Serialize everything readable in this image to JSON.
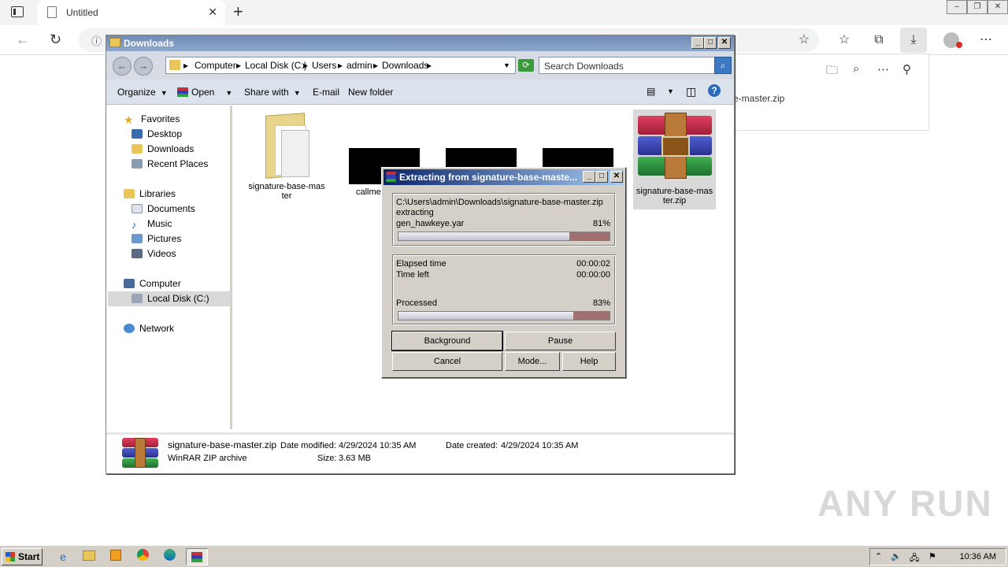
{
  "browser": {
    "tab_title": "Untitled",
    "download_item": "e-master.zip"
  },
  "explorer": {
    "title": "Downloads",
    "breadcrumbs": [
      "Computer",
      "Local Disk (C:)",
      "Users",
      "admin",
      "Downloads"
    ],
    "search_placeholder": "Search Downloads",
    "commands": {
      "organize": "Organize",
      "open": "Open",
      "share_with": "Share with",
      "email": "E-mail",
      "new_folder": "New folder"
    },
    "nav": {
      "favorites": "Favorites",
      "desktop": "Desktop",
      "downloads": "Downloads",
      "recent_places": "Recent Places",
      "libraries": "Libraries",
      "documents": "Documents",
      "music": "Music",
      "pictures": "Pictures",
      "videos": "Videos",
      "computer": "Computer",
      "local_disk": "Local Disk (C:)",
      "network": "Network"
    },
    "files": {
      "folder_name_1": "signature-base-mas",
      "folder_name_2": "ter",
      "call_name": "callmet",
      "zip_name_1": "signature-base-mas",
      "zip_name_2": "ter.zip"
    },
    "details": {
      "name": "signature-base-master.zip",
      "type": "WinRAR ZIP archive",
      "date_modified_label": "Date modified:",
      "date_modified": "4/29/2024 10:35 AM",
      "date_created_label": "Date created:",
      "date_created": "4/29/2024 10:35 AM",
      "size_label": "Size:",
      "size": "3.63 MB"
    }
  },
  "dialog": {
    "title": "Extracting from signature-base-maste...",
    "path": "C:\\Users\\admin\\Downloads\\signature-base-master.zip",
    "action": "extracting",
    "current_file": "gen_hawkeye.yar",
    "file_percent": "81%",
    "file_progress": 0.81,
    "elapsed_label": "Elapsed time",
    "elapsed": "00:00:02",
    "left_label": "Time left",
    "left": "00:00:00",
    "processed_label": "Processed",
    "processed_percent": "83%",
    "processed_progress": 0.83,
    "buttons": {
      "background": "Background",
      "pause": "Pause",
      "cancel": "Cancel",
      "mode": "Mode...",
      "help": "Help"
    }
  },
  "taskbar": {
    "start": "Start",
    "clock": "10:36 AM"
  },
  "watermark": "ANY RUN",
  "colors": {
    "dialog_title_start": "#0a246a",
    "dialog_title_end": "#a6caf0",
    "progress_remaining": "#a07070"
  }
}
